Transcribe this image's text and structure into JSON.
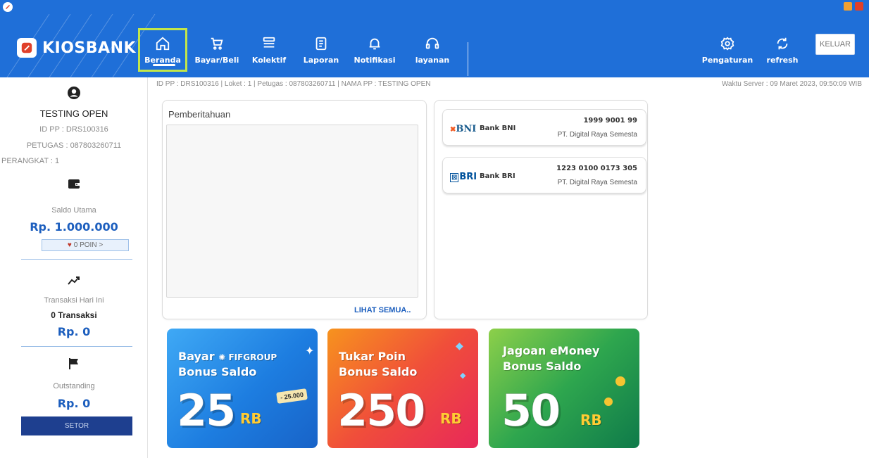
{
  "header": {
    "logo_text": "KIOSBANK",
    "nav": [
      {
        "label": "Beranda",
        "icon": "home-icon"
      },
      {
        "label": "Bayar/Beli",
        "icon": "cart-icon"
      },
      {
        "label": "Kolektif",
        "icon": "list-icon"
      },
      {
        "label": "Laporan",
        "icon": "report-icon"
      },
      {
        "label": "Notifikasi",
        "icon": "bell-icon"
      },
      {
        "label": "layanan",
        "icon": "headset-icon"
      }
    ],
    "settings_label": "Pengaturan",
    "refresh_label": "refresh",
    "logout_label": "KELUAR",
    "colors": {
      "primary": "#1f6fd8",
      "active_border": "#c2e64a"
    }
  },
  "info_bar": {
    "text": "ID PP : DRS100316 | Loket : 1 | Petugas : 087803260711 | NAMA PP : TESTING OPEN",
    "server_time": "Waktu Server : 09 Maret 2023, 09:50:09 WIB"
  },
  "sidebar": {
    "name": "TESTING OPEN",
    "id_pp": "ID PP : DRS100316",
    "petugas": "PETUGAS : 087803260711",
    "perangkat": "PERANGKAT : 1",
    "saldo_label": "Saldo Utama",
    "saldo_value": "Rp. 1.000.000",
    "poin_label": "0 POIN >",
    "trx_label": "Transaksi Hari Ini",
    "trx_count": "0 Transaksi",
    "trx_value": "Rp. 0",
    "outstanding_label": "Outstanding",
    "outstanding_value": "Rp. 0",
    "setor_label": "SETOR"
  },
  "notice": {
    "title": "Pemberitahuan",
    "see_all": "LIHAT SEMUA.."
  },
  "banks": [
    {
      "logo": "BNI",
      "name": "Bank BNI",
      "account": "1999 9001 99",
      "owner": "PT. Digital Raya Semesta"
    },
    {
      "logo": "BRI",
      "name": "Bank BRI",
      "account": "1223 0100 0173 305",
      "owner": "PT. Digital Raya Semesta"
    }
  ],
  "banners": [
    {
      "line1": "Bayar",
      "brand": "FIFGROUP",
      "line2": "Bonus Saldo",
      "big": "25",
      "unit": "RB",
      "tag": "25.000"
    },
    {
      "line1": "Tukar Poin",
      "line2": "Bonus Saldo",
      "big": "250",
      "unit": "RB"
    },
    {
      "line1": "Jagoan eMoney",
      "line2": "Bonus Saldo",
      "big": "50",
      "unit": "RB"
    }
  ]
}
